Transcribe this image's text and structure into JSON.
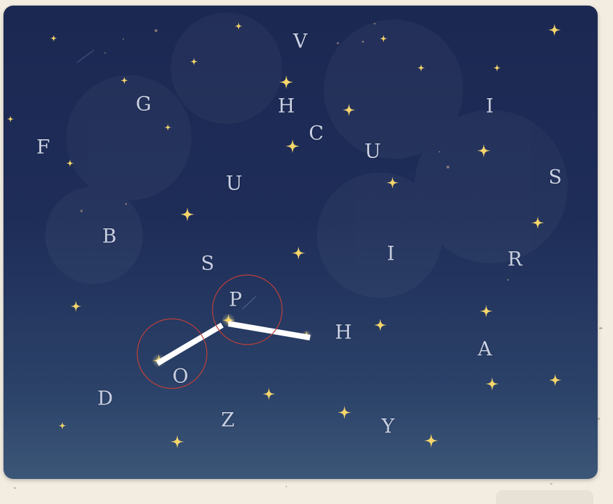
{
  "letters": [
    {
      "id": "v",
      "char": "V"
    },
    {
      "id": "g",
      "char": "G"
    },
    {
      "id": "h1",
      "char": "H"
    },
    {
      "id": "i1",
      "char": "I"
    },
    {
      "id": "c",
      "char": "C"
    },
    {
      "id": "f",
      "char": "F"
    },
    {
      "id": "u1",
      "char": "U"
    },
    {
      "id": "u2",
      "char": "U"
    },
    {
      "id": "s1",
      "char": "S"
    },
    {
      "id": "b",
      "char": "B"
    },
    {
      "id": "i2",
      "char": "I"
    },
    {
      "id": "r",
      "char": "R"
    },
    {
      "id": "s2",
      "char": "S"
    },
    {
      "id": "p",
      "char": "P"
    },
    {
      "id": "h2",
      "char": "H"
    },
    {
      "id": "a",
      "char": "A"
    },
    {
      "id": "o",
      "char": "O"
    },
    {
      "id": "d",
      "char": "D"
    },
    {
      "id": "z",
      "char": "Z"
    },
    {
      "id": "y",
      "char": "Y"
    }
  ],
  "colors": {
    "sky_top": "#1b2852",
    "sky_bottom": "#3b5677",
    "star": "#f6d66a",
    "letter": "#c9cfe0",
    "trace_line": "#ffffff",
    "selection_ring": "#c0403a",
    "paper": "#f3ede1"
  },
  "icons": {
    "star": "four-point-star-icon"
  }
}
